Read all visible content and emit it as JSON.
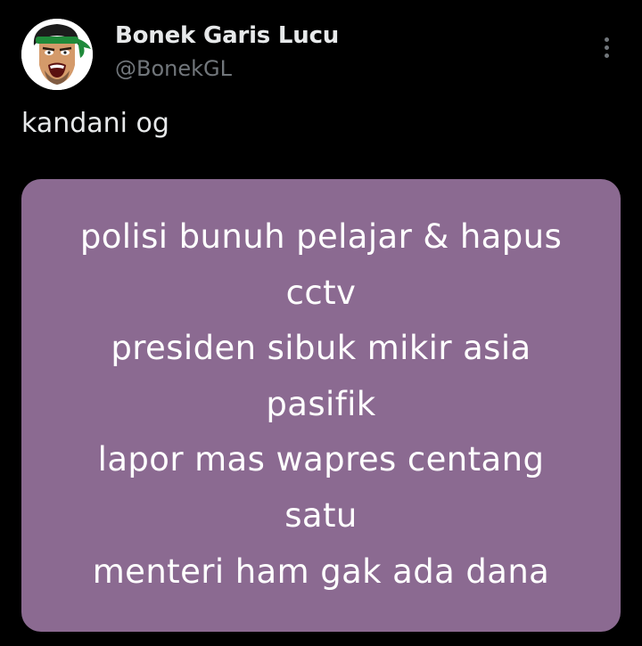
{
  "tweet": {
    "author": {
      "display_name": "Bonek Garis Lucu",
      "handle": "@BonekGL",
      "avatar_icon": "avatar-icon"
    },
    "more_icon": "more-vertical-icon",
    "text": "kandani og",
    "media": {
      "background_color": "#8b6a91",
      "lines": [
        "polisi bunuh pelajar & hapus",
        "cctv",
        "presiden sibuk mikir asia",
        "pasifik",
        "lapor mas wapres centang",
        "satu",
        "menteri ham gak ada dana"
      ]
    }
  }
}
